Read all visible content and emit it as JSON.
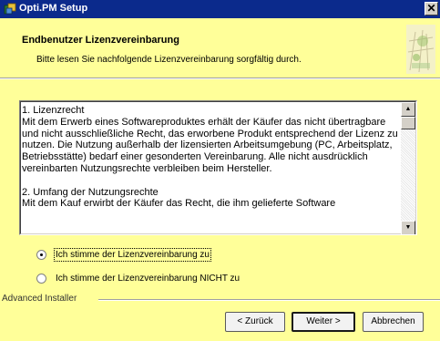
{
  "window": {
    "title": "Opti.PM Setup",
    "close_glyph": "✕"
  },
  "header": {
    "title": "Endbenutzer Lizenzvereinbarung",
    "subtitle": "Bitte lesen Sie nachfolgende Lizenzvereinbarung sorgfältig durch."
  },
  "license": {
    "text": "1. Lizenzrecht\nMit dem Erwerb eines Softwareproduktes erhält der Käufer das nicht übertragbare und nicht ausschließliche Recht, das erworbene Produkt entsprechend der Lizenz zu nutzen. Die Nutzung außerhalb der lizensierten Arbeitsumgebung (PC, Arbeitsplatz, Betriebsstätte) bedarf einer gesonderten Vereinbarung. Alle nicht ausdrücklich vereinbarten Nutzungsrechte verbleiben beim Hersteller.\n\n2. Umfang der Nutzungsrechte\nMit dem Kauf erwirbt der Käufer das Recht, die ihm gelieferte Software",
    "scroll_up": "▲",
    "scroll_down": "▼"
  },
  "options": {
    "accept_label": "Ich stimme der Lizenzvereinbarung zu",
    "decline_label": "Ich stimme der Lizenzvereinbarung NICHT zu",
    "selected": "accept"
  },
  "footer": {
    "brand": "Advanced Installer",
    "back_label": "< Zurück",
    "next_label": "Weiter >",
    "cancel_label": "Abbrechen"
  },
  "colors": {
    "background": "#ffff99",
    "titlebar": "#0b2a8c"
  }
}
